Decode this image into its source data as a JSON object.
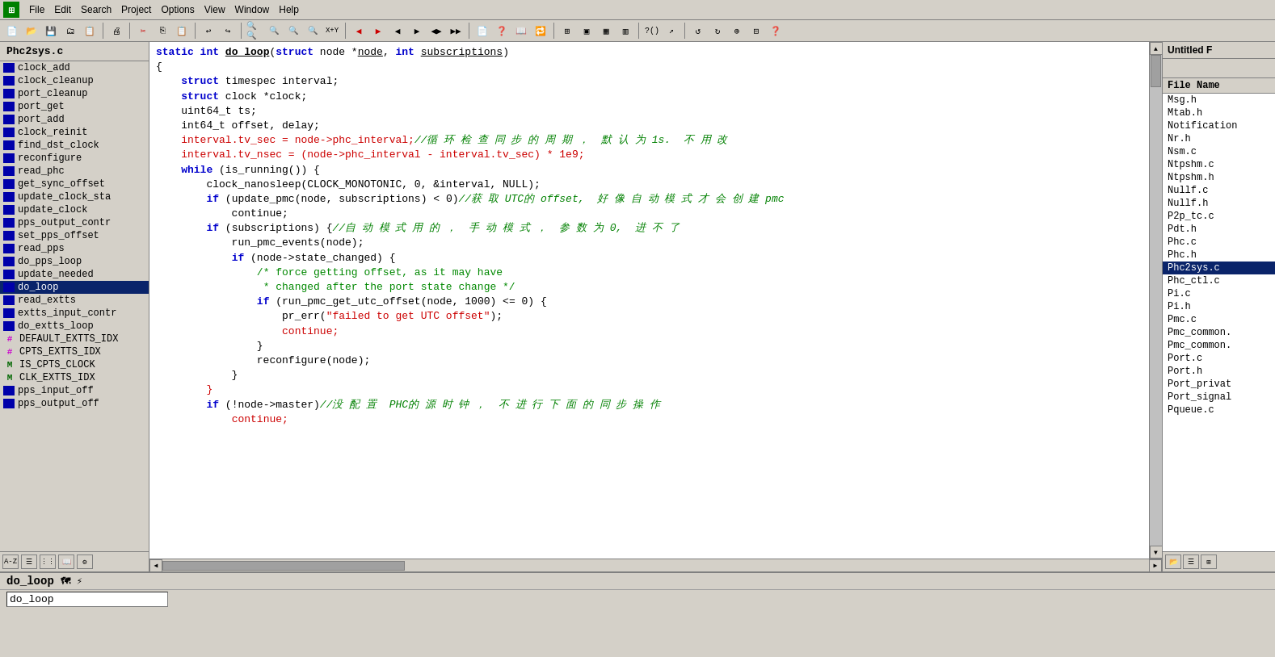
{
  "menubar": {
    "items": [
      "File",
      "Edit",
      "Search",
      "Project",
      "Options",
      "View",
      "Window",
      "Help"
    ]
  },
  "sidebar": {
    "title": "Phc2sys.c",
    "items": [
      {
        "label": "clock_add",
        "icon": "blue"
      },
      {
        "label": "clock_cleanup",
        "icon": "blue"
      },
      {
        "label": "port_cleanup",
        "icon": "blue"
      },
      {
        "label": "port_get",
        "icon": "blue"
      },
      {
        "label": "port_add",
        "icon": "blue"
      },
      {
        "label": "clock_reinit",
        "icon": "blue"
      },
      {
        "label": "find_dst_clock",
        "icon": "blue"
      },
      {
        "label": "reconfigure",
        "icon": "blue"
      },
      {
        "label": "read_phc",
        "icon": "blue"
      },
      {
        "label": "get_sync_offset",
        "icon": "blue"
      },
      {
        "label": "update_clock_sta",
        "icon": "blue"
      },
      {
        "label": "update_clock",
        "icon": "blue"
      },
      {
        "label": "pps_output_contr",
        "icon": "blue"
      },
      {
        "label": "set_pps_offset",
        "icon": "blue"
      },
      {
        "label": "read_pps",
        "icon": "blue"
      },
      {
        "label": "do_pps_loop",
        "icon": "blue"
      },
      {
        "label": "update_needed",
        "icon": "blue"
      },
      {
        "label": "do_loop",
        "icon": "blue",
        "selected": true
      },
      {
        "label": "read_extts",
        "icon": "blue"
      },
      {
        "label": "extts_input_contr",
        "icon": "blue"
      },
      {
        "label": "do_extts_loop",
        "icon": "blue"
      },
      {
        "label": "DEFAULT_EXTTS_IDX",
        "icon": "hash"
      },
      {
        "label": "CPTS_EXTTS_IDX",
        "icon": "hash"
      },
      {
        "label": "IS_CPTS_CLOCK",
        "icon": "m"
      },
      {
        "label": "CLK_EXTTS_IDX",
        "icon": "m"
      },
      {
        "label": "pps_input_off",
        "icon": "blue"
      },
      {
        "label": "pps_output_off",
        "icon": "blue"
      }
    ]
  },
  "right_panel": {
    "title": "Untitled F",
    "items": [
      {
        "label": "File Name",
        "header": true
      },
      {
        "label": "Msg.h"
      },
      {
        "label": "Mtab.h"
      },
      {
        "label": "Notification"
      },
      {
        "label": "Nr.h"
      },
      {
        "label": "Nsm.c"
      },
      {
        "label": "Ntpshm.c"
      },
      {
        "label": "Ntpshm.h"
      },
      {
        "label": "Nullf.c"
      },
      {
        "label": "Nullf.h"
      },
      {
        "label": "P2p_tc.c"
      },
      {
        "label": "Pdt.h"
      },
      {
        "label": "Phc.c"
      },
      {
        "label": "Phc.h"
      },
      {
        "label": "Phc2sys.c",
        "selected": true
      },
      {
        "label": "Phc_ctl.c"
      },
      {
        "label": "Pi.c"
      },
      {
        "label": "Pi.h"
      },
      {
        "label": "Pmc.c"
      },
      {
        "label": "Pmc_common."
      },
      {
        "label": "Pmc_common."
      },
      {
        "label": "Port.c"
      },
      {
        "label": "Port.h"
      },
      {
        "label": "Port_privat"
      },
      {
        "label": "Port_signal"
      },
      {
        "label": "Pqueue.c"
      }
    ]
  },
  "status": {
    "function_name": "do_loop",
    "search_text": "do_loop"
  }
}
